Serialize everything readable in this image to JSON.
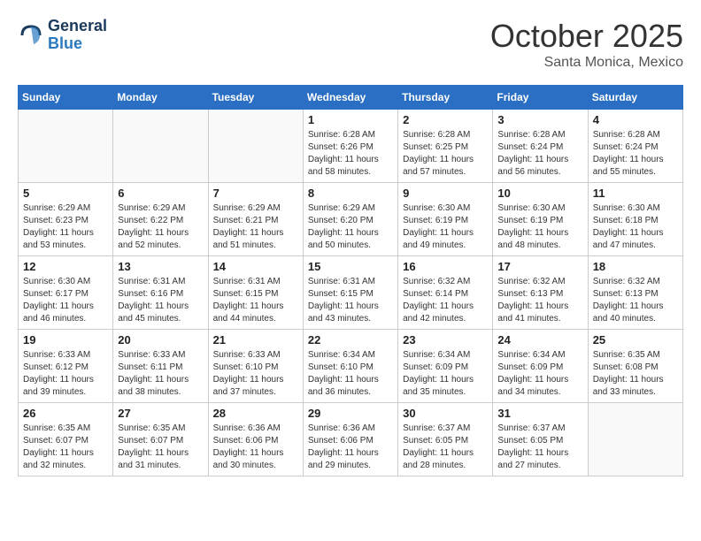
{
  "header": {
    "logo_line1": "General",
    "logo_line2": "Blue",
    "month": "October 2025",
    "location": "Santa Monica, Mexico"
  },
  "weekdays": [
    "Sunday",
    "Monday",
    "Tuesday",
    "Wednesday",
    "Thursday",
    "Friday",
    "Saturday"
  ],
  "weeks": [
    [
      {
        "day": "",
        "info": ""
      },
      {
        "day": "",
        "info": ""
      },
      {
        "day": "",
        "info": ""
      },
      {
        "day": "1",
        "info": "Sunrise: 6:28 AM\nSunset: 6:26 PM\nDaylight: 11 hours\nand 58 minutes."
      },
      {
        "day": "2",
        "info": "Sunrise: 6:28 AM\nSunset: 6:25 PM\nDaylight: 11 hours\nand 57 minutes."
      },
      {
        "day": "3",
        "info": "Sunrise: 6:28 AM\nSunset: 6:24 PM\nDaylight: 11 hours\nand 56 minutes."
      },
      {
        "day": "4",
        "info": "Sunrise: 6:28 AM\nSunset: 6:24 PM\nDaylight: 11 hours\nand 55 minutes."
      }
    ],
    [
      {
        "day": "5",
        "info": "Sunrise: 6:29 AM\nSunset: 6:23 PM\nDaylight: 11 hours\nand 53 minutes."
      },
      {
        "day": "6",
        "info": "Sunrise: 6:29 AM\nSunset: 6:22 PM\nDaylight: 11 hours\nand 52 minutes."
      },
      {
        "day": "7",
        "info": "Sunrise: 6:29 AM\nSunset: 6:21 PM\nDaylight: 11 hours\nand 51 minutes."
      },
      {
        "day": "8",
        "info": "Sunrise: 6:29 AM\nSunset: 6:20 PM\nDaylight: 11 hours\nand 50 minutes."
      },
      {
        "day": "9",
        "info": "Sunrise: 6:30 AM\nSunset: 6:19 PM\nDaylight: 11 hours\nand 49 minutes."
      },
      {
        "day": "10",
        "info": "Sunrise: 6:30 AM\nSunset: 6:19 PM\nDaylight: 11 hours\nand 48 minutes."
      },
      {
        "day": "11",
        "info": "Sunrise: 6:30 AM\nSunset: 6:18 PM\nDaylight: 11 hours\nand 47 minutes."
      }
    ],
    [
      {
        "day": "12",
        "info": "Sunrise: 6:30 AM\nSunset: 6:17 PM\nDaylight: 11 hours\nand 46 minutes."
      },
      {
        "day": "13",
        "info": "Sunrise: 6:31 AM\nSunset: 6:16 PM\nDaylight: 11 hours\nand 45 minutes."
      },
      {
        "day": "14",
        "info": "Sunrise: 6:31 AM\nSunset: 6:15 PM\nDaylight: 11 hours\nand 44 minutes."
      },
      {
        "day": "15",
        "info": "Sunrise: 6:31 AM\nSunset: 6:15 PM\nDaylight: 11 hours\nand 43 minutes."
      },
      {
        "day": "16",
        "info": "Sunrise: 6:32 AM\nSunset: 6:14 PM\nDaylight: 11 hours\nand 42 minutes."
      },
      {
        "day": "17",
        "info": "Sunrise: 6:32 AM\nSunset: 6:13 PM\nDaylight: 11 hours\nand 41 minutes."
      },
      {
        "day": "18",
        "info": "Sunrise: 6:32 AM\nSunset: 6:13 PM\nDaylight: 11 hours\nand 40 minutes."
      }
    ],
    [
      {
        "day": "19",
        "info": "Sunrise: 6:33 AM\nSunset: 6:12 PM\nDaylight: 11 hours\nand 39 minutes."
      },
      {
        "day": "20",
        "info": "Sunrise: 6:33 AM\nSunset: 6:11 PM\nDaylight: 11 hours\nand 38 minutes."
      },
      {
        "day": "21",
        "info": "Sunrise: 6:33 AM\nSunset: 6:10 PM\nDaylight: 11 hours\nand 37 minutes."
      },
      {
        "day": "22",
        "info": "Sunrise: 6:34 AM\nSunset: 6:10 PM\nDaylight: 11 hours\nand 36 minutes."
      },
      {
        "day": "23",
        "info": "Sunrise: 6:34 AM\nSunset: 6:09 PM\nDaylight: 11 hours\nand 35 minutes."
      },
      {
        "day": "24",
        "info": "Sunrise: 6:34 AM\nSunset: 6:09 PM\nDaylight: 11 hours\nand 34 minutes."
      },
      {
        "day": "25",
        "info": "Sunrise: 6:35 AM\nSunset: 6:08 PM\nDaylight: 11 hours\nand 33 minutes."
      }
    ],
    [
      {
        "day": "26",
        "info": "Sunrise: 6:35 AM\nSunset: 6:07 PM\nDaylight: 11 hours\nand 32 minutes."
      },
      {
        "day": "27",
        "info": "Sunrise: 6:35 AM\nSunset: 6:07 PM\nDaylight: 11 hours\nand 31 minutes."
      },
      {
        "day": "28",
        "info": "Sunrise: 6:36 AM\nSunset: 6:06 PM\nDaylight: 11 hours\nand 30 minutes."
      },
      {
        "day": "29",
        "info": "Sunrise: 6:36 AM\nSunset: 6:06 PM\nDaylight: 11 hours\nand 29 minutes."
      },
      {
        "day": "30",
        "info": "Sunrise: 6:37 AM\nSunset: 6:05 PM\nDaylight: 11 hours\nand 28 minutes."
      },
      {
        "day": "31",
        "info": "Sunrise: 6:37 AM\nSunset: 6:05 PM\nDaylight: 11 hours\nand 27 minutes."
      },
      {
        "day": "",
        "info": ""
      }
    ]
  ]
}
